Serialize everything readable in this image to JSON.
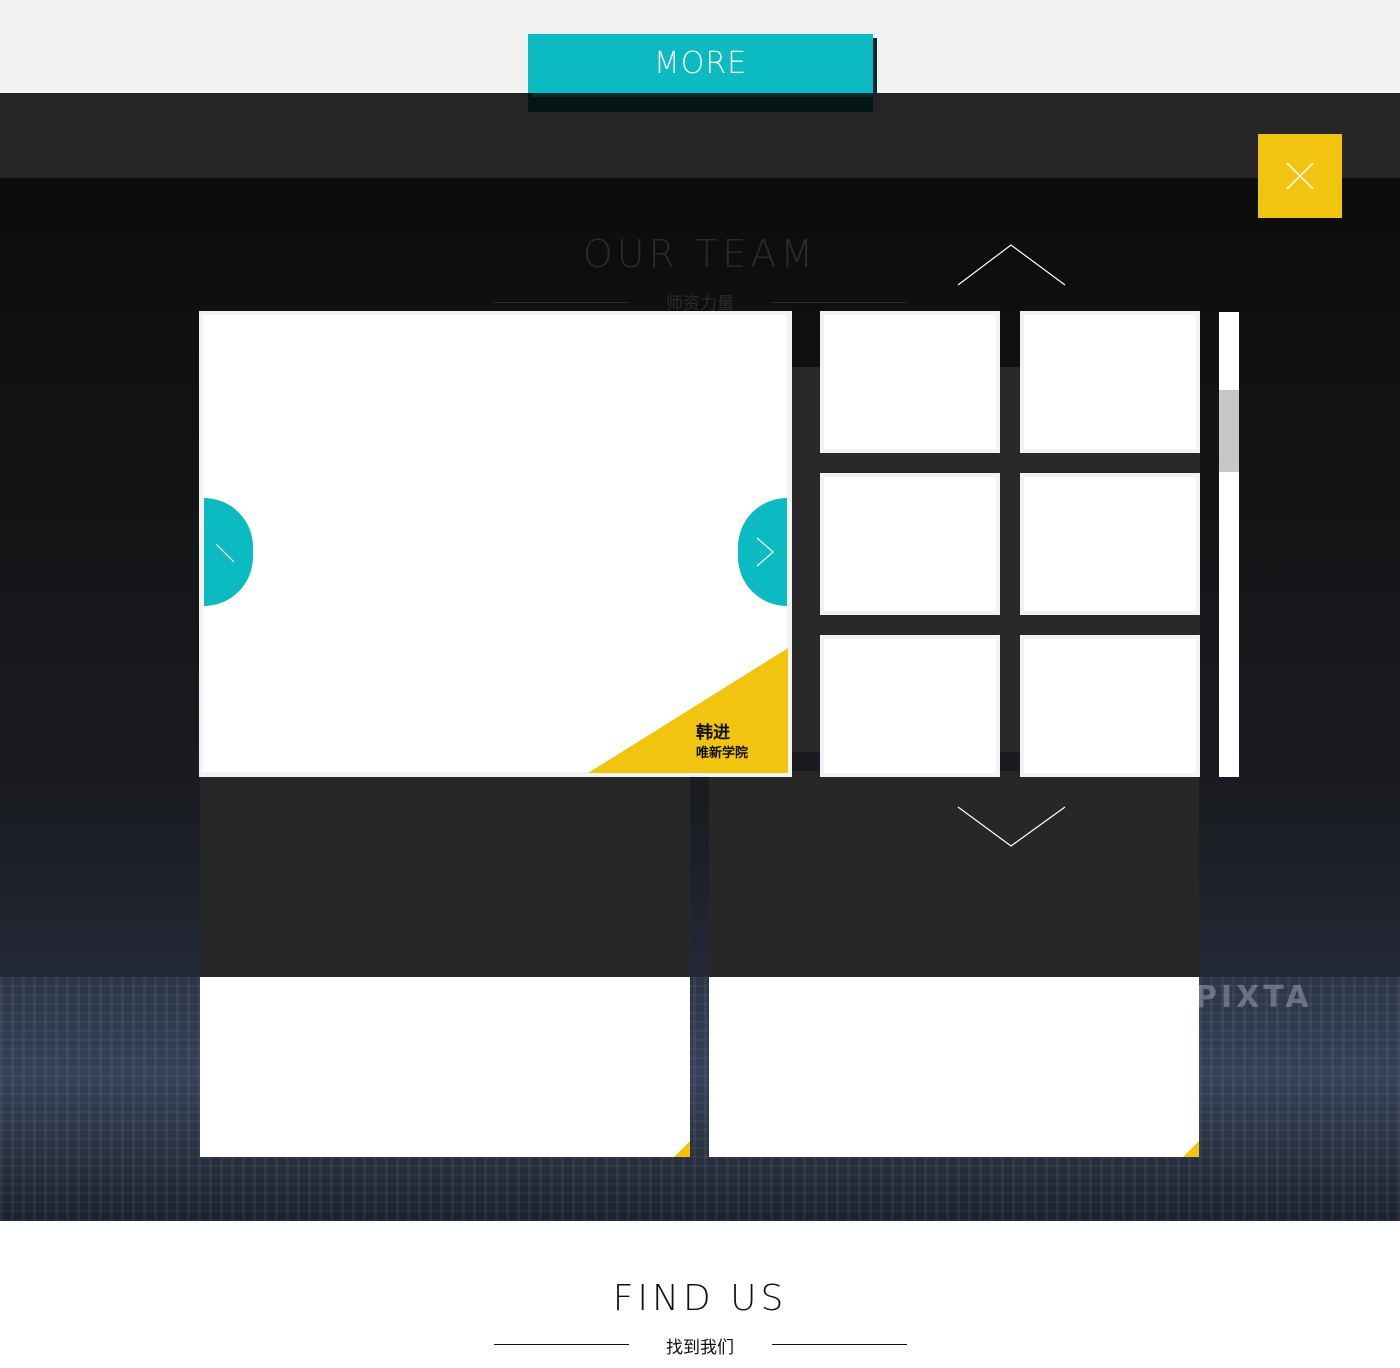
{
  "more_button": {
    "label": "MORE"
  },
  "team": {
    "title": "OUR TEAM",
    "subtitle": "师资力量"
  },
  "modal": {
    "featured": {
      "name": "韩进",
      "organization": "唯新学院"
    },
    "thumbnails": [
      {},
      {},
      {},
      {},
      {},
      {}
    ]
  },
  "find_us": {
    "title": "FIND US",
    "subtitle": "找到我们"
  },
  "watermark": "PIXTA",
  "colors": {
    "accent": "#0cbac1",
    "highlight": "#f1c40f",
    "dark": "#252525"
  },
  "icons": {
    "close": "close-icon",
    "prev": "chevron-left-icon",
    "next": "chevron-right-icon",
    "up": "chevron-up-icon",
    "down": "chevron-down-icon"
  }
}
